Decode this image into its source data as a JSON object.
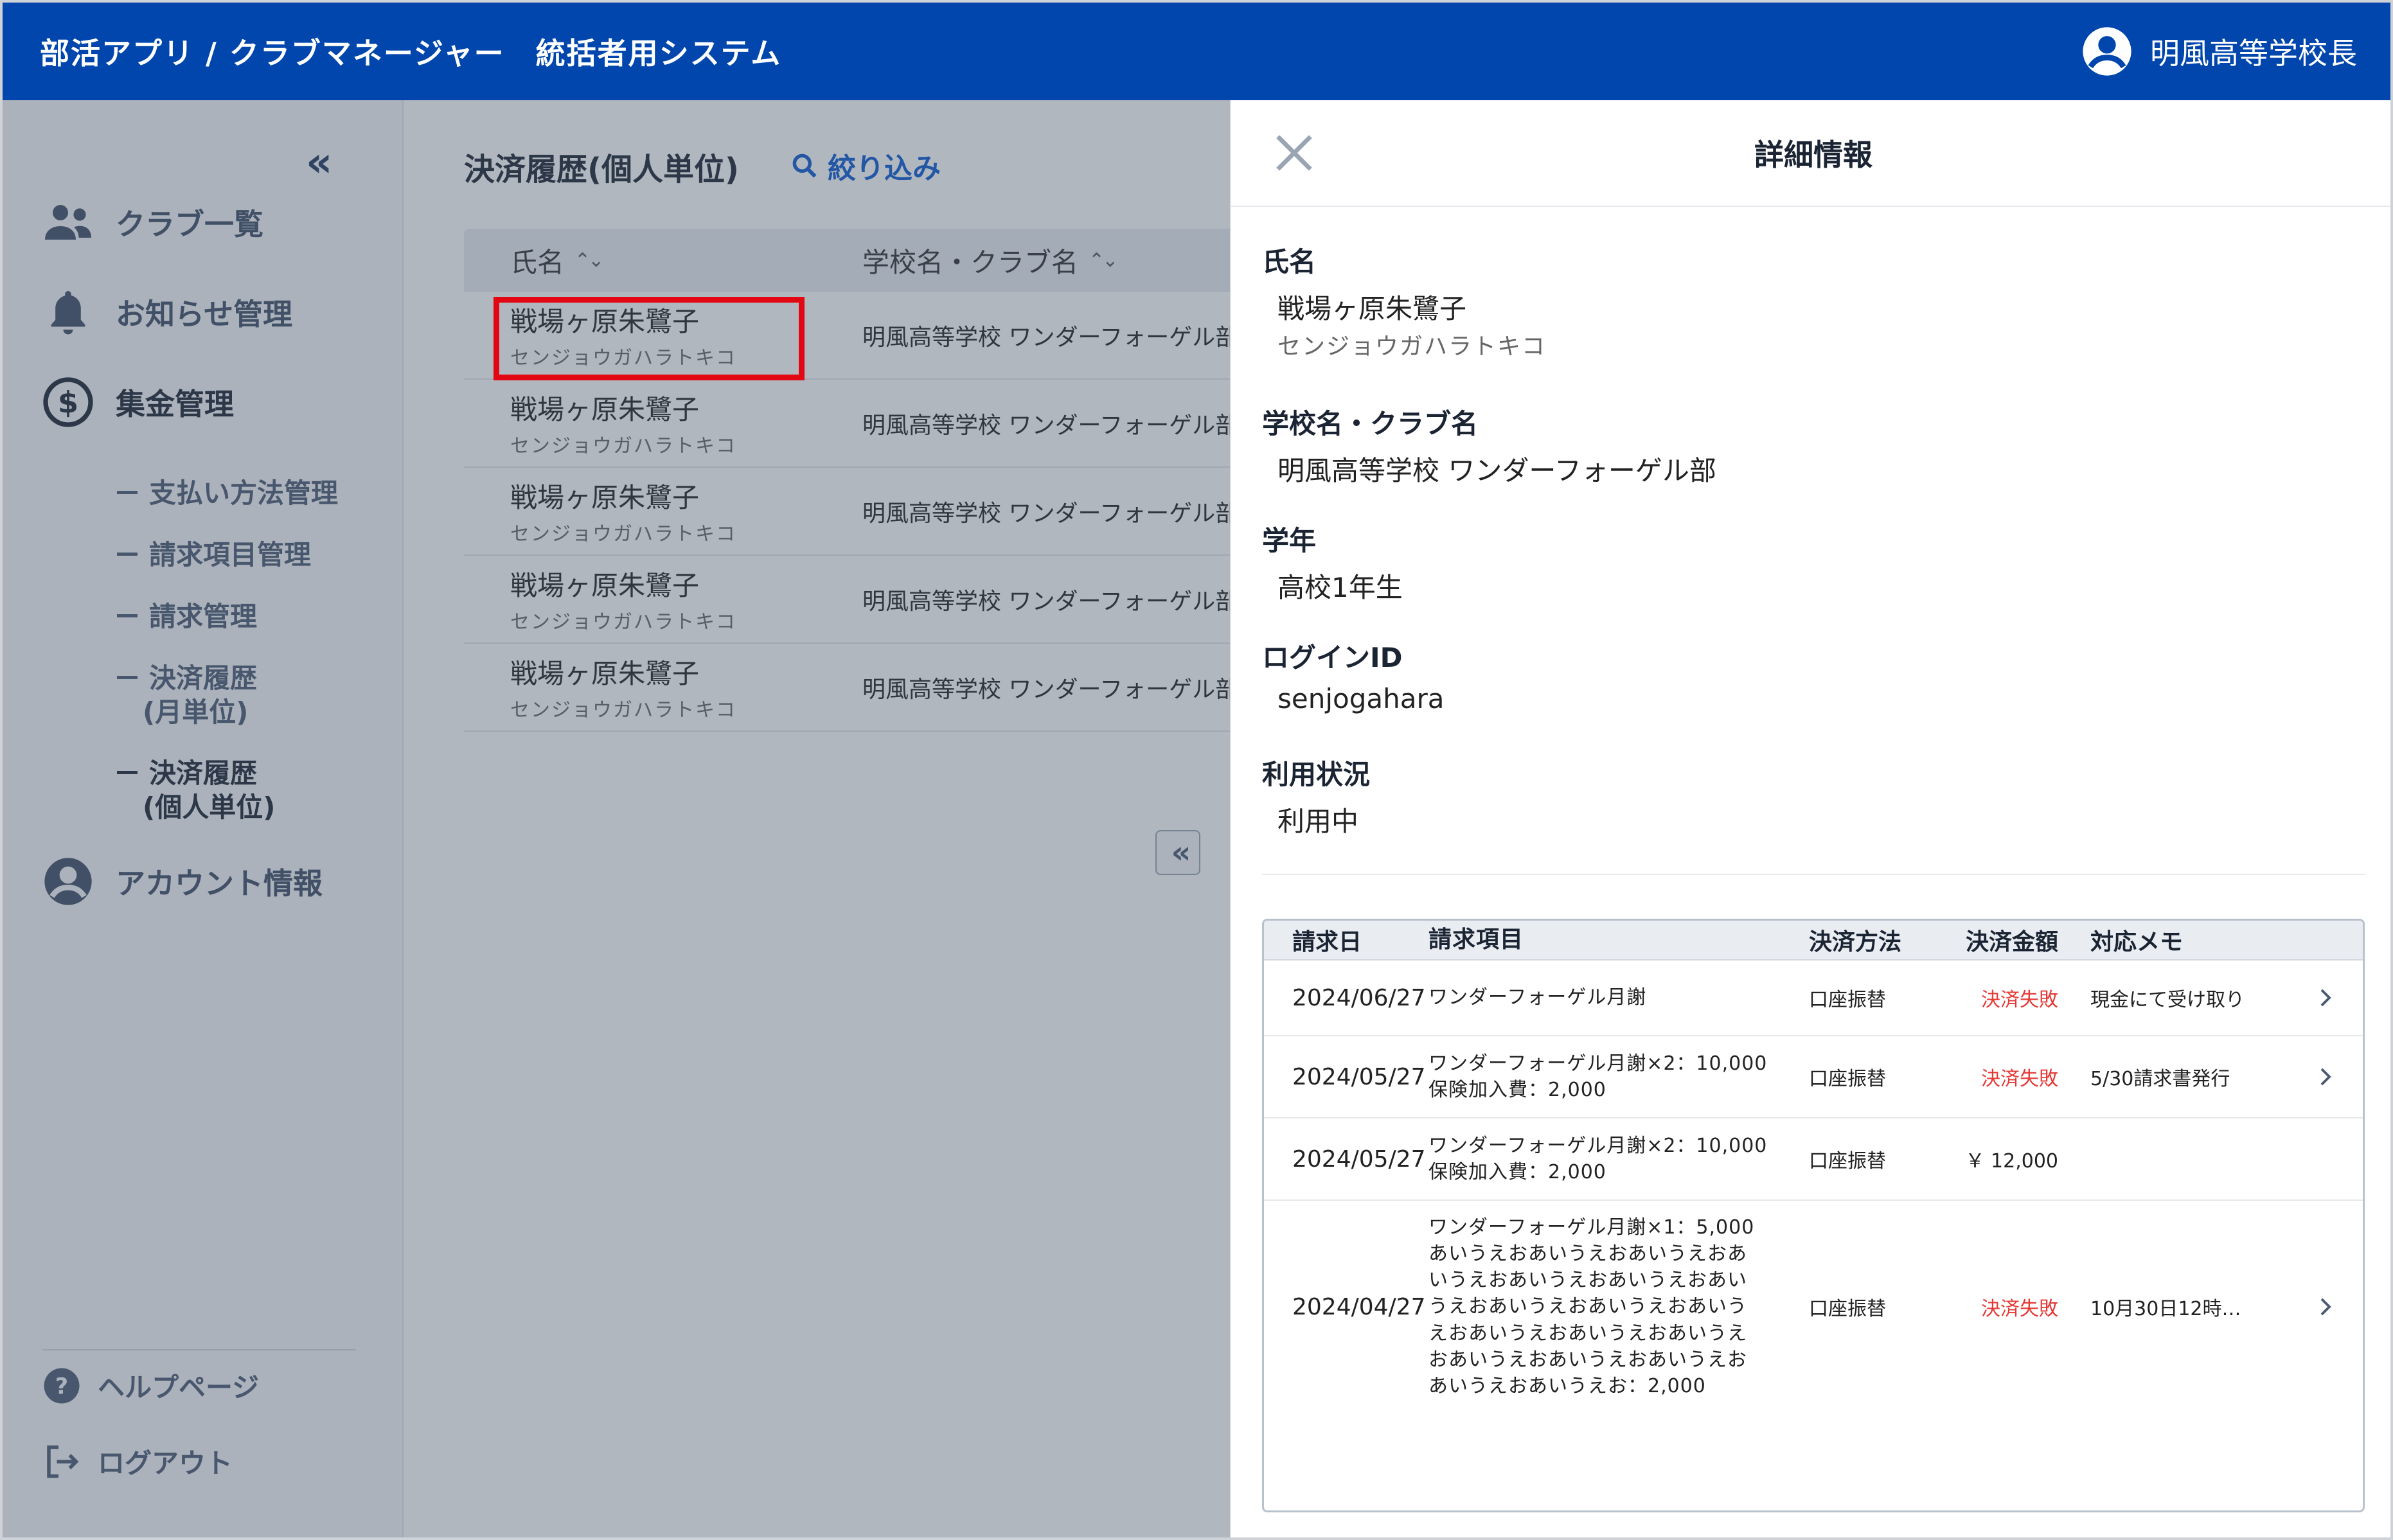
{
  "header": {
    "title": "部活アプリ / クラブマネージャー　統括者用システム",
    "user_name": "明風高等学校長"
  },
  "sidebar": {
    "collapse_icon": "double-chevron-left-icon",
    "items": [
      {
        "label": "クラブ一覧",
        "icon": "users-icon"
      },
      {
        "label": "お知らせ管理",
        "icon": "bell-icon"
      },
      {
        "label": "集金管理",
        "icon": "dollar-circle-icon"
      },
      {
        "label": "アカウント情報",
        "icon": "account-circle-icon"
      }
    ],
    "sub_items": [
      {
        "label": "支払い方法管理"
      },
      {
        "label": "請求項目管理"
      },
      {
        "label": "請求管理"
      },
      {
        "label": "決済履歴",
        "label2": "(月単位)"
      },
      {
        "label": "決済履歴",
        "label2": "(個人単位)"
      }
    ],
    "footer": [
      {
        "label": "ヘルプページ",
        "icon": "help-circle-icon"
      },
      {
        "label": "ログアウト",
        "icon": "logout-icon"
      }
    ]
  },
  "main": {
    "title": "決済履歴(個人単位)",
    "filter_label": "絞り込み",
    "columns": [
      "氏名",
      "学校名・クラブ名"
    ],
    "rows": [
      {
        "name": "戦場ヶ原朱鷺子",
        "kana": "センジョウガハラトキコ",
        "school": "明風高等学校 ワンダーフォーゲル部"
      },
      {
        "name": "戦場ヶ原朱鷺子",
        "kana": "センジョウガハラトキコ",
        "school": "明風高等学校 ワンダーフォーゲル部"
      },
      {
        "name": "戦場ヶ原朱鷺子",
        "kana": "センジョウガハラトキコ",
        "school": "明風高等学校 ワンダーフォーゲル部"
      },
      {
        "name": "戦場ヶ原朱鷺子",
        "kana": "センジョウガハラトキコ",
        "school": "明風高等学校 ワンダーフォーゲル部"
      },
      {
        "name": "戦場ヶ原朱鷺子",
        "kana": "センジョウガハラトキコ",
        "school": "明風高等学校 ワンダーフォーゲル部"
      }
    ]
  },
  "drawer": {
    "title": "詳細情報",
    "fields": {
      "name_label": "氏名",
      "name_value": "戦場ヶ原朱鷺子",
      "name_kana": "センジョウガハラトキコ",
      "school_label": "学校名・クラブ名",
      "school_value": "明風高等学校 ワンダーフォーゲル部",
      "grade_label": "学年",
      "grade_value": "高校1年生",
      "login_label": "ログインID",
      "login_value": "senjogahara",
      "status_label": "利用状況",
      "status_value": "利用中"
    },
    "payments": {
      "columns": [
        "請求日",
        "請求項目",
        "決済方法",
        "決済金額",
        "対応メモ"
      ],
      "rows": [
        {
          "date": "2024/06/27",
          "item": "ワンダーフォーゲル月謝",
          "method": "口座振替",
          "amount": "決済失敗",
          "failed": true,
          "memo": "現金にて受け取り",
          "arrow": true
        },
        {
          "date": "2024/05/27",
          "item": "ワンダーフォーゲル月謝×2：10,000\n保険加入費：2,000",
          "method": "口座振替",
          "amount": "決済失敗",
          "failed": true,
          "memo": "5/30請求書発行",
          "arrow": true
        },
        {
          "date": "2024/05/27",
          "item": "ワンダーフォーゲル月謝×2：10,000\n保険加入費：2,000",
          "method": "口座振替",
          "amount": "￥ 12,000",
          "failed": false,
          "memo": "",
          "arrow": false
        },
        {
          "date": "2024/04/27",
          "item": "ワンダーフォーゲル月謝×1：5,000\nあいうえおあいうえおあいうえおあ\nいうえおあいうえおあいうえおあい\nうえおあいうえおあいうえおあいう\nえおあいうえおあいうえおあいうえ\nおあいうえおあいうえおあいうえお\nあいうえおあいうえお：2,000",
          "method": "口座振替",
          "amount": "決済失敗",
          "failed": true,
          "memo": "10月30日12時…",
          "arrow": true
        }
      ]
    }
  },
  "colors": {
    "header_bg": "#0046ad",
    "link": "#0b5bd3",
    "fail": "#e53935",
    "highlight": "#e30613"
  }
}
